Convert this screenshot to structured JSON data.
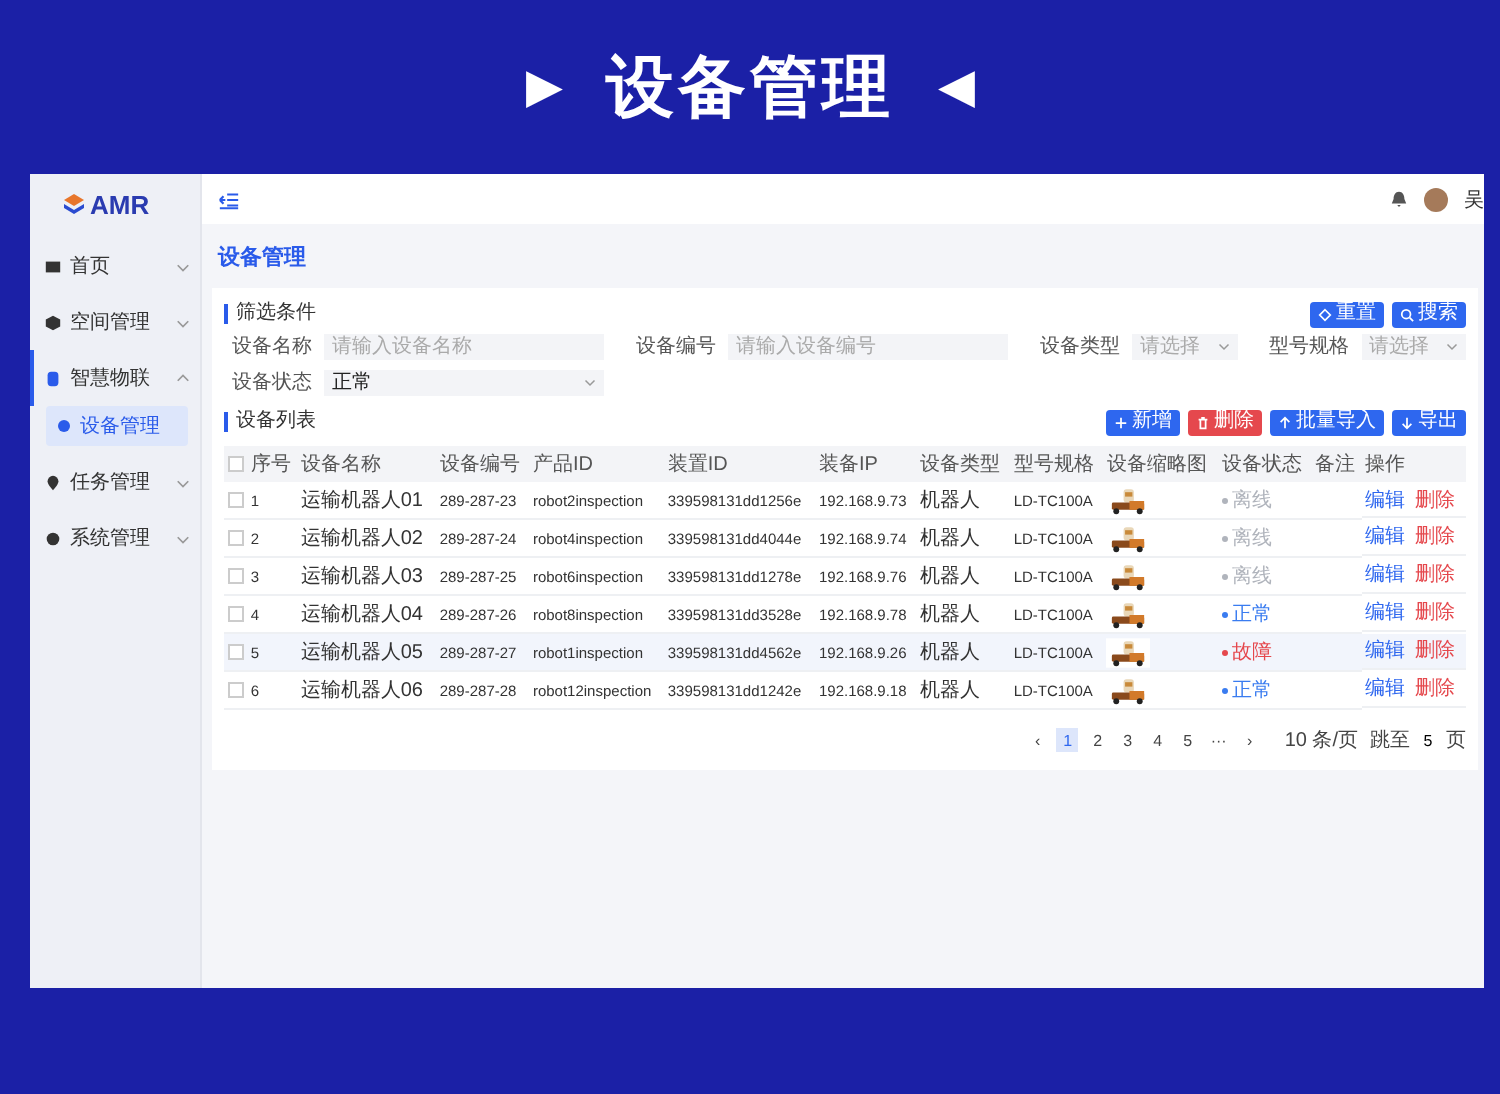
{
  "banner": {
    "left_mark": "▶",
    "title": "设备管理",
    "right_mark": "◀"
  },
  "logo": "AMR",
  "user": "吴",
  "sidebar": [
    {
      "label": "首页",
      "expanded": false,
      "selected": false
    },
    {
      "label": "空间管理",
      "expanded": false,
      "selected": false
    },
    {
      "label": "智慧物联",
      "expanded": true,
      "selected": true,
      "children": [
        {
          "label": "设备管理",
          "selected": true
        }
      ]
    },
    {
      "label": "任务管理",
      "expanded": false,
      "selected": false
    },
    {
      "label": "系统管理",
      "expanded": false,
      "selected": false
    }
  ],
  "page_title": "设备管理",
  "filter": {
    "title": "筛选条件",
    "fields": [
      {
        "label": "设备名称",
        "kind": "input",
        "placeholder": "请输入设备名称"
      },
      {
        "label": "设备编号",
        "kind": "input",
        "placeholder": "请输入设备编号"
      },
      {
        "label": "设备类型",
        "kind": "select",
        "placeholder": "请选择"
      },
      {
        "label": "型号规格",
        "kind": "select",
        "placeholder": "请选择"
      },
      {
        "label": "设备状态",
        "kind": "select",
        "value": "正常"
      }
    ],
    "buttons": [
      {
        "label": "重置",
        "kind": "reset"
      },
      {
        "label": "搜索",
        "kind": "search"
      }
    ]
  },
  "list": {
    "title": "设备列表",
    "all_checked": false,
    "buttons": [
      {
        "label": "新增",
        "kind": "add"
      },
      {
        "label": "删除",
        "kind": "delete"
      },
      {
        "label": "批量导入",
        "kind": "import"
      },
      {
        "label": "导出",
        "kind": "export"
      }
    ],
    "columns": [
      "序号",
      "设备名称",
      "设备编号",
      "产品ID",
      "装置ID",
      "装备IP",
      "设备类型",
      "型号规格",
      "设备缩略图",
      "设备状态",
      "备注",
      "操作"
    ],
    "rows": [
      {
        "checked": false,
        "selected": false,
        "no": "1",
        "name": "运输机器人01",
        "code": "289-287-23",
        "product_id": "robot2inspection",
        "device_id": "339598131dd1256e",
        "ip": "192.168.9.73",
        "type": "机器人",
        "model": "LD-TC100A",
        "status": "离线",
        "color": "#b0b4bc",
        "actions": [
          "编辑",
          "删除"
        ]
      },
      {
        "checked": false,
        "selected": false,
        "no": "2",
        "name": "运输机器人02",
        "code": "289-287-24",
        "product_id": "robot4inspection",
        "device_id": "339598131dd4044e",
        "ip": "192.168.9.74",
        "type": "机器人",
        "model": "LD-TC100A",
        "status": "离线",
        "color": "#b0b4bc",
        "actions": [
          "编辑",
          "删除"
        ]
      },
      {
        "checked": false,
        "selected": false,
        "no": "3",
        "name": "运输机器人03",
        "code": "289-287-25",
        "product_id": "robot6inspection",
        "device_id": "339598131dd1278e",
        "ip": "192.168.9.76",
        "type": "机器人",
        "model": "LD-TC100A",
        "status": "离线",
        "color": "#b0b4bc",
        "actions": [
          "编辑",
          "删除"
        ]
      },
      {
        "checked": false,
        "selected": false,
        "no": "4",
        "name": "运输机器人04",
        "code": "289-287-26",
        "product_id": "robot8inspection",
        "device_id": "339598131dd3528e",
        "ip": "192.168.9.78",
        "type": "机器人",
        "model": "LD-TC100A",
        "status": "正常",
        "color": "#3a7cf0",
        "actions": [
          "编辑",
          "删除"
        ]
      },
      {
        "checked": false,
        "selected": true,
        "no": "5",
        "name": "运输机器人05",
        "code": "289-287-27",
        "product_id": "robot1inspection",
        "device_id": "339598131dd4562e",
        "ip": "192.168.9.26",
        "type": "机器人",
        "model": "LD-TC100A",
        "status": "故障",
        "color": "#e5484d",
        "actions": [
          "编辑",
          "删除"
        ]
      },
      {
        "checked": false,
        "selected": false,
        "no": "6",
        "name": "运输机器人06",
        "code": "289-287-28",
        "product_id": "robot12inspection",
        "device_id": "339598131dd1242e",
        "ip": "192.168.9.18",
        "type": "机器人",
        "model": "LD-TC100A",
        "status": "正常",
        "color": "#3a7cf0",
        "actions": [
          "编辑",
          "删除"
        ]
      }
    ]
  },
  "pagination": {
    "prev": "‹",
    "pages": [
      {
        "label": "1",
        "selected": true
      },
      {
        "label": "2",
        "selected": false
      },
      {
        "label": "3",
        "selected": false
      },
      {
        "label": "4",
        "selected": false
      },
      {
        "label": "5",
        "selected": false
      }
    ],
    "ellipsis": "···",
    "next": "›",
    "page_size": "10 条/页",
    "goto_label": "跳至",
    "goto_value": "5",
    "goto_unit": "页"
  }
}
